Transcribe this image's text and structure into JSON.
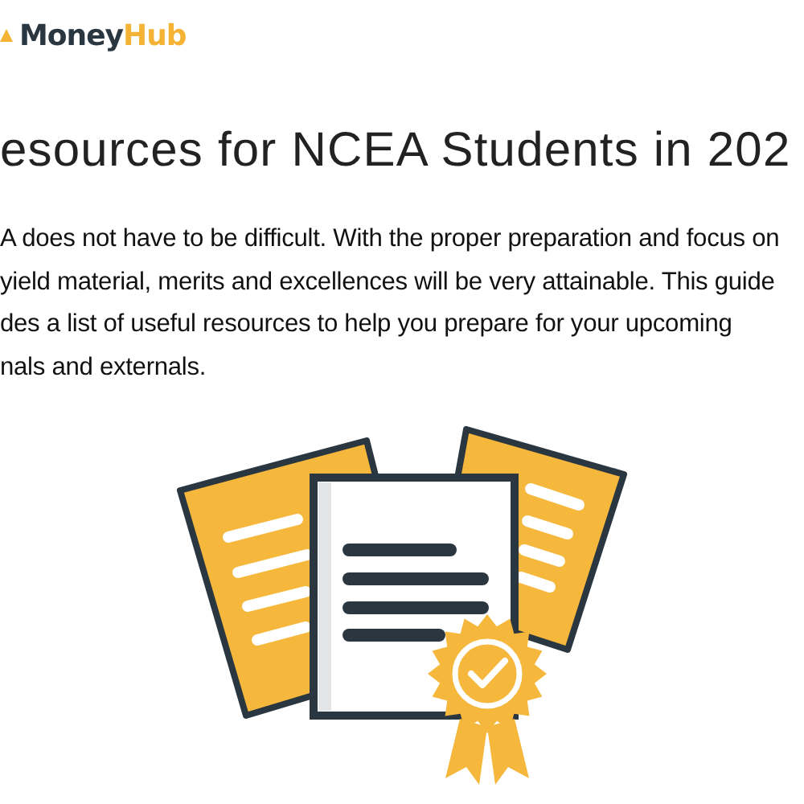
{
  "logo": {
    "primary": "Money",
    "accent": "Hub"
  },
  "title": "esources for NCEA Students in 202",
  "intro_lines": [
    "A does not have to be difficult. With the proper preparation and focus on",
    "yield material, merits and excellences will be very attainable. This guide",
    "des a list of useful resources to help you prepare for your upcoming",
    "nals and externals."
  ]
}
